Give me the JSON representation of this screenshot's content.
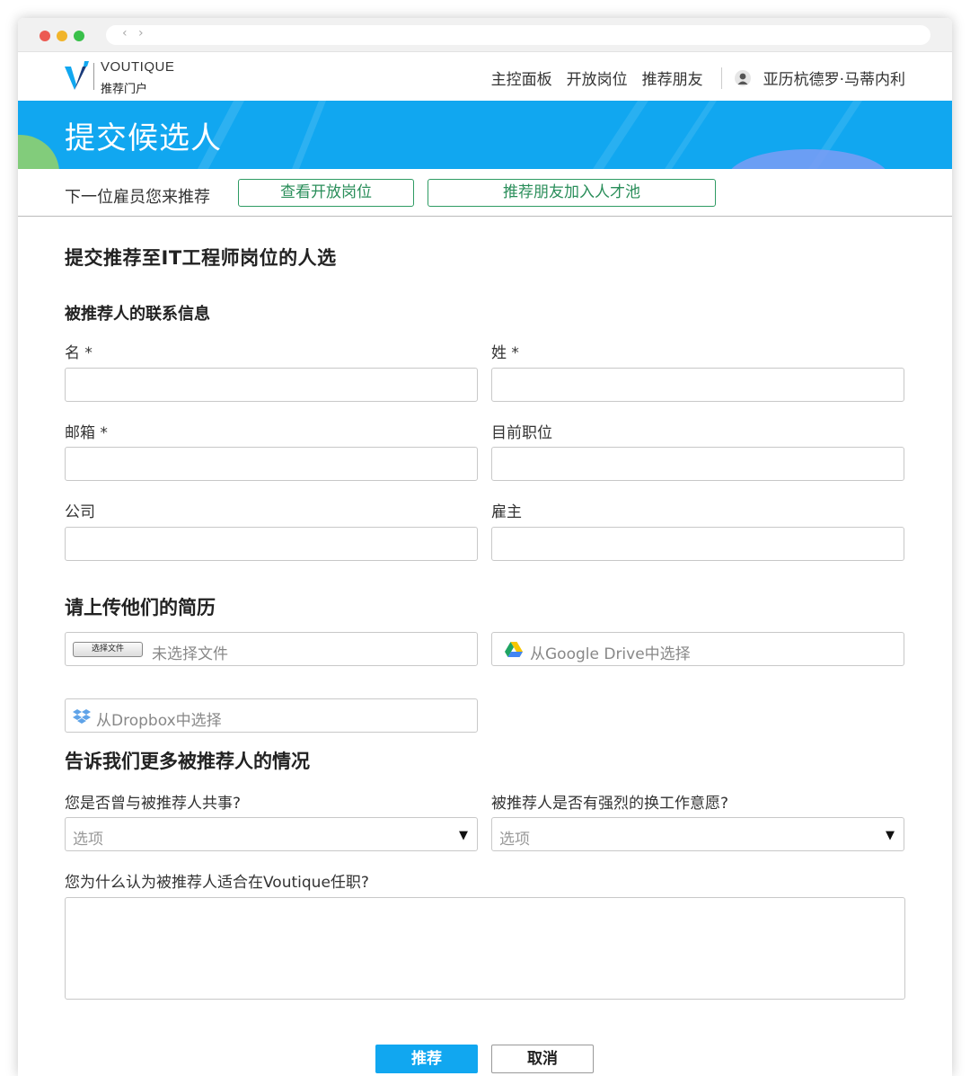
{
  "browser": {
    "nav_arrows": "‹ ›"
  },
  "header": {
    "brand": "VOUTIQUE",
    "brand_sub": "推荐门户",
    "nav": [
      "主控面板",
      "开放岗位",
      "推荐朋友"
    ],
    "user_name": "亚历杭德罗·马蒂内利"
  },
  "banner": {
    "title": "提交候选人"
  },
  "refbar": {
    "text": "下一位雇员您来推荐",
    "view_jobs_label": "查看开放岗位",
    "refer_friend_label": "推荐朋友加入人才池"
  },
  "form": {
    "title": "提交推荐至IT工程师岗位的人选",
    "contact_heading": "被推荐人的联系信息",
    "fields": {
      "first_name": "名 *",
      "last_name": "姓 *",
      "email": "邮箱 *",
      "current_title": "目前职位",
      "company": "公司",
      "employer": "雇主"
    },
    "resume_heading": "请上传他们的简历",
    "file_button": "选择文件",
    "file_status": "未选择文件",
    "google_drive": "从Google Drive中选择",
    "dropbox": "从Dropbox中选择",
    "more_heading": "告诉我们更多被推荐人的情况",
    "q_worked_together": "您是否曾与被推荐人共事?",
    "q_desire_change": "被推荐人是否有强烈的换工作意愿?",
    "select_placeholder": "选项",
    "q_why_fit": "您为什么认为被推荐人适合在Voutique任职?",
    "submit_label": "推荐",
    "cancel_label": "取消"
  },
  "colors": {
    "accent": "#11a7f0",
    "green": "#2e9b63"
  }
}
